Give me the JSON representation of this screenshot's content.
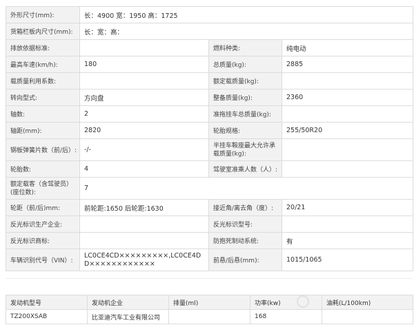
{
  "spec": {
    "dimensions_label": "外形尺寸(mm):",
    "dimensions_value": "长：4900 宽：1950 高：1725",
    "cargo_box_label": "货箱栏板内尺寸(mm):",
    "cargo_box_value": "长：宽：高：",
    "emission_label": "排放依据标准:",
    "emission_value": "",
    "fuel_label": "燃料种类:",
    "fuel_value": "纯电动",
    "max_speed_label": "最高车速(km/h):",
    "max_speed_value": "180",
    "gross_mass_label": "总质量(kg):",
    "gross_mass_value": "2885",
    "load_util_label": "载质量利用系数:",
    "load_util_value": "",
    "rated_load_label": "额定载质量(kg):",
    "rated_load_value": "",
    "steering_label": "转向型式:",
    "steering_value": "方向盘",
    "curb_mass_label": "整备质量(kg):",
    "curb_mass_value": "2360",
    "axles_label": "轴数:",
    "axles_value": "2",
    "trailer_mass_label": "准拖挂车总质量(kg):",
    "trailer_mass_value": "",
    "wheelbase_label": "轴距(mm):",
    "wheelbase_value": "2820",
    "tire_label": "轮胎规格:",
    "tire_value": "255/50R20",
    "springs_label": "钢板弹簧片数（前/后）:",
    "springs_value": "-/-",
    "semi_trailer_label": "半挂车鞍座最大允许承载质量(kg):",
    "semi_trailer_value": "",
    "tires_count_label": "轮胎数:",
    "tires_count_value": "4",
    "cab_seats_label": "驾驶室准乘人数（人）:",
    "cab_seats_value": "",
    "rated_passengers_label": "额定载客（含驾驶员）(座位数):",
    "rated_passengers_value": "7",
    "track_label": "轮距（前/后)mm:",
    "track_value": "前轮距:1650 后轮距:1630",
    "approach_label": "接近角/离去角（度）:",
    "approach_value": "20/21",
    "reflector_maker_label": "反光标识生产企业:",
    "reflector_maker_value": "",
    "reflector_model_label": "反光标识型号:",
    "reflector_model_value": "",
    "reflector_brand_label": "反光标识商标:",
    "reflector_brand_value": "",
    "abs_label": "防抱死制动系统:",
    "abs_value": "有",
    "vin_label": "车辆识别代号（VIN）:",
    "vin_value": "LC0CE4CD×××××××××,LC0CE4DD××××××××××××",
    "overhang_label": "前悬/后悬(mm):",
    "overhang_value": "1015/1065"
  },
  "engine": {
    "headers": [
      "发动机型号",
      "发动机企业",
      "排量(ml)",
      "功率(kw)",
      "油耗(L/100km)"
    ],
    "row": [
      "TZ200XSAB",
      "比亚迪汽车工业有限公司",
      "",
      "168",
      ""
    ]
  }
}
